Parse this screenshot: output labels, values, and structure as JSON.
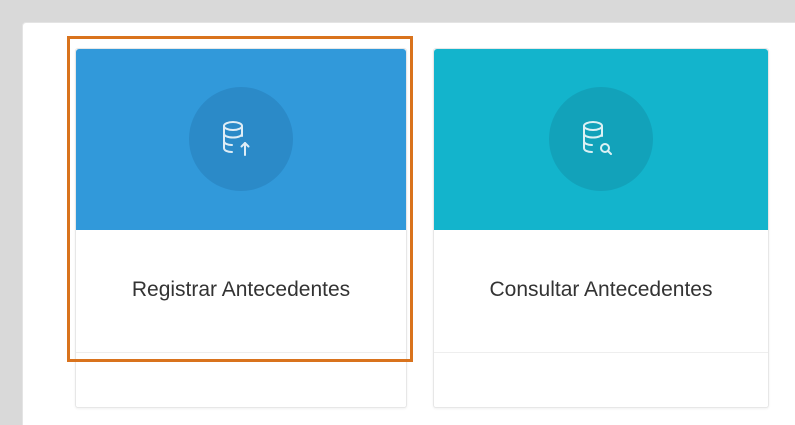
{
  "cards": [
    {
      "label": "Registrar Antecedentes",
      "icon": "database-upload-icon",
      "header_color": "#3199da",
      "selected": true
    },
    {
      "label": "Consultar Antecedentes",
      "icon": "database-search-icon",
      "header_color": "#13b4cc",
      "selected": false
    }
  ],
  "colors": {
    "highlight": "#d9731d"
  }
}
